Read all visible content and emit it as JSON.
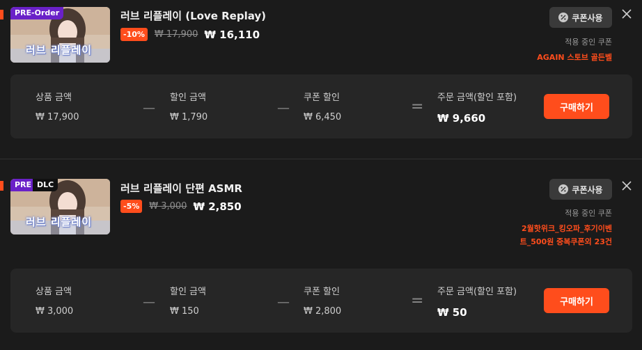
{
  "currency_symbol": "₩",
  "colors": {
    "accent": "#ff4d1c",
    "badge_purple": "#6a21c8",
    "background": "#1b1b1b",
    "panel": "#262626"
  },
  "summary_labels": {
    "product_amount": "상품 금액",
    "discount_amount": "할인 금액",
    "coupon_discount": "쿠폰 할인",
    "order_amount": "주문 금액(할인 포함)"
  },
  "operators": {
    "minus": "—",
    "equals": "="
  },
  "items": [
    {
      "badges": [
        "PRE-Order"
      ],
      "thumbnail_title": "러브 리플레이",
      "title": "러브 리플레이 (Love Replay)",
      "discount_badge": "-10%",
      "original_price": "₩ 17,900",
      "final_price": "₩ 16,110",
      "coupon_button": "쿠폰사용",
      "coupon_icon": "percent-tag-icon",
      "applied_coupon_label": "적용 중인 쿠폰",
      "applied_coupon_name": "AGAIN 스토브 골든벨",
      "summary": {
        "product_amount": "₩ 17,900",
        "discount_amount": "₩ 1,790",
        "coupon_discount": "₩ 6,450",
        "order_amount": "₩ 9,660"
      },
      "buy_button": "구매하기"
    },
    {
      "badges": [
        "PRE",
        "DLC"
      ],
      "thumbnail_title": "러브 리플레이",
      "title": "러브 리플레이 단편 ASMR",
      "discount_badge": "-5%",
      "original_price": "₩ 3,000",
      "final_price": "₩ 2,850",
      "coupon_button": "쿠폰사용",
      "coupon_icon": "percent-tag-icon",
      "applied_coupon_label": "적용 중인 쿠폰",
      "applied_coupon_name": "2월핫위크_킹오파_후기이벤트_500원 중복쿠폰외 23건",
      "summary": {
        "product_amount": "₩ 3,000",
        "discount_amount": "₩ 150",
        "coupon_discount": "₩ 2,800",
        "order_amount": "₩ 50"
      },
      "buy_button": "구매하기"
    }
  ]
}
